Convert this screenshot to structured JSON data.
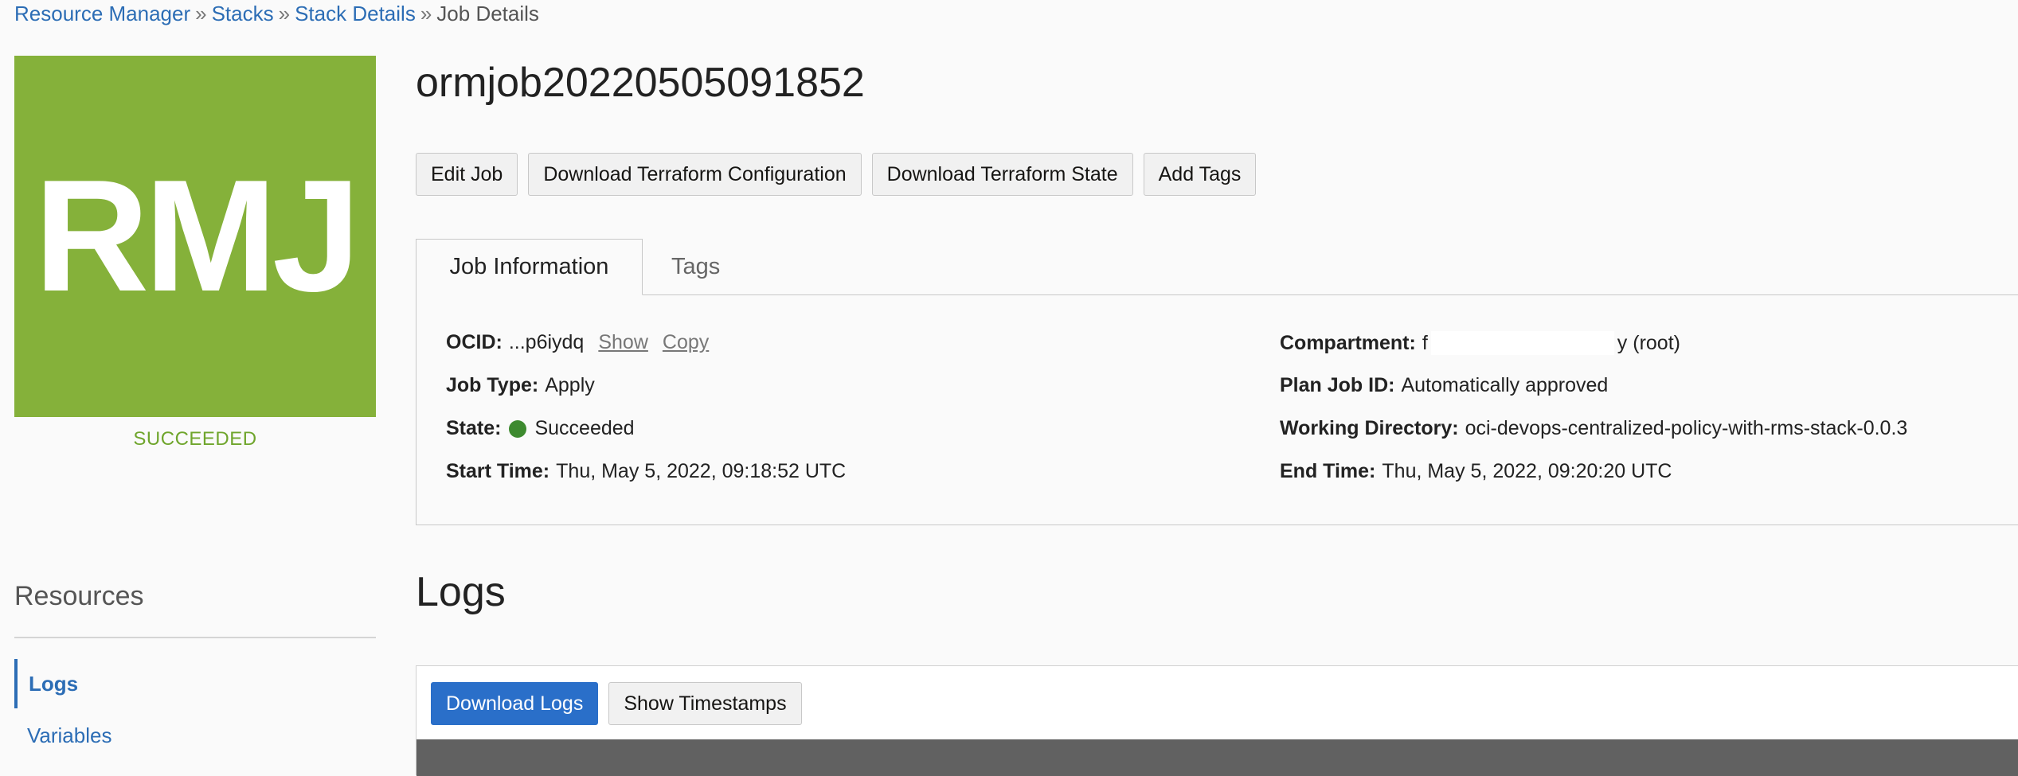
{
  "breadcrumb": {
    "items": [
      {
        "label": "Resource Manager"
      },
      {
        "label": "Stacks"
      },
      {
        "label": "Stack Details"
      }
    ],
    "current": "Job Details",
    "separator": "»"
  },
  "job": {
    "icon_text": "RMJ",
    "state_label": "SUCCEEDED",
    "title": "ormjob20220505091852"
  },
  "actions": {
    "edit_job": "Edit Job",
    "download_config": "Download Terraform Configuration",
    "download_state": "Download Terraform State",
    "add_tags": "Add Tags"
  },
  "tabs": {
    "job_information": "Job Information",
    "tags": "Tags"
  },
  "info": {
    "ocid_label": "OCID:",
    "ocid_value": "...p6iydq",
    "ocid_show": "Show",
    "ocid_copy": "Copy",
    "job_type_label": "Job Type:",
    "job_type_value": "Apply",
    "state_label": "State:",
    "state_value": "Succeeded",
    "start_time_label": "Start Time:",
    "start_time_value": "Thu, May 5, 2022, 09:18:52 UTC",
    "compartment_label": "Compartment:",
    "compartment_prefix": "f",
    "compartment_suffix": "y (root)",
    "plan_job_label": "Plan Job ID:",
    "plan_job_value": "Automatically approved",
    "working_dir_label": "Working Directory:",
    "working_dir_value": "oci-devops-centralized-policy-with-rms-stack-0.0.3",
    "end_time_label": "End Time:",
    "end_time_value": "Thu, May 5, 2022, 09:20:20 UTC"
  },
  "resources": {
    "title": "Resources",
    "items": [
      {
        "label": "Logs"
      },
      {
        "label": "Variables"
      }
    ]
  },
  "logs": {
    "title": "Logs",
    "download_button": "Download Logs",
    "timestamps_button": "Show Timestamps"
  },
  "colors": {
    "accent": "#2c6db5",
    "job_icon_bg": "#85b13a",
    "success": "#6fa52c",
    "status_dot": "#3d8a2f",
    "console_bg": "#616161"
  }
}
